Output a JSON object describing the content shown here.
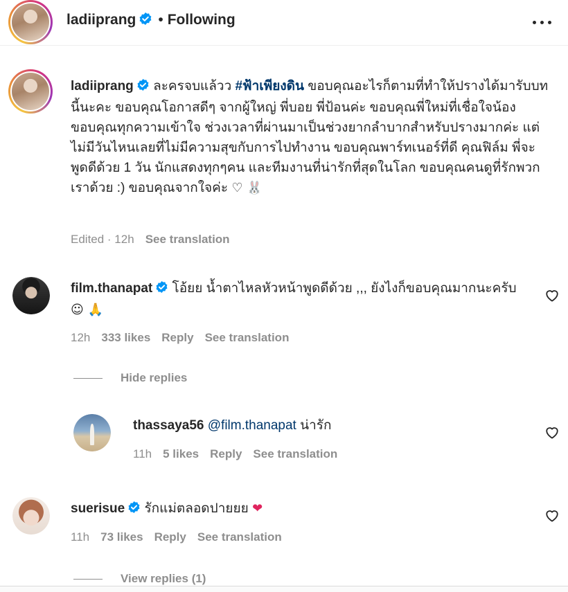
{
  "header": {
    "username": "ladiiprang",
    "separator": "•",
    "follow_status": "Following"
  },
  "caption": {
    "username": "ladiiprang",
    "text_before_tag": "ละครจบแล้วว",
    "hashtag": "#ฟ้าเพียงดิน",
    "text_after_tag": "ขอบคุณอะไรก็ตามที่ทำให้ปรางได้มารับบทนี้นะคะ ขอบคุณโอกาสดีๆ จากผู้ใหญ่ พี่บอย พี่ป้อนค่ะ ขอบคุณพี่ใหม่ที่เชื่อใจน้อง ขอบคุณทุกความเข้าใจ ช่วงเวลาที่ผ่านมาเป็นช่วงยากลำบากสำหรับปรางมากค่ะ แต่ไม่มีวันไหนเลยที่ไม่มีความสุขกับการไปทำงาน ขอบคุณพาร์ทเนอร์ที่ดี คุณฟิล์ม พี่จะพูดดีด้วย 1 วัน นักแสดงทุกๆคน และทีมงานที่น่ารักที่สุดในโลก ขอบคุณคนดูที่รักพวกเราด้วย :) ขอบคุณจากใจค่ะ",
    "emoji": "♡ 🐰",
    "edited": "Edited · 12h",
    "see_translation": "See translation"
  },
  "comments": [
    {
      "username": "film.thanapat",
      "verified": true,
      "text": "โอ้ยย น้ำตาไหลหัวหน้าพูดดีด้วย ,,, ยังไงก็ขอบคุณมากนะครับ",
      "emoji": "☺ 🙏",
      "time": "12h",
      "likes": "333 likes",
      "reply": "Reply",
      "see_translation": "See translation"
    },
    {
      "username": "thassaya56",
      "verified": false,
      "mention": "@film.thanapat",
      "text": "น่ารัก",
      "time": "11h",
      "likes": "5 likes",
      "reply": "Reply",
      "see_translation": "See translation"
    },
    {
      "username": "suerisue",
      "verified": true,
      "text": "รักแม่ตลอดปายยย",
      "emoji": "❤",
      "time": "11h",
      "likes": "73 likes",
      "reply": "Reply",
      "see_translation": "See translation"
    }
  ],
  "hide_replies": "Hide replies",
  "view_replies": "View replies (1)",
  "icons": {
    "verified": "verified-badge-icon",
    "more": "more-options-icon",
    "heart": "heart-outline-icon"
  },
  "colors": {
    "verified_blue": "#0095f6",
    "link_blue": "#00376b",
    "muted_gray": "#8e8e8e",
    "heart_red": "#e0245e"
  }
}
